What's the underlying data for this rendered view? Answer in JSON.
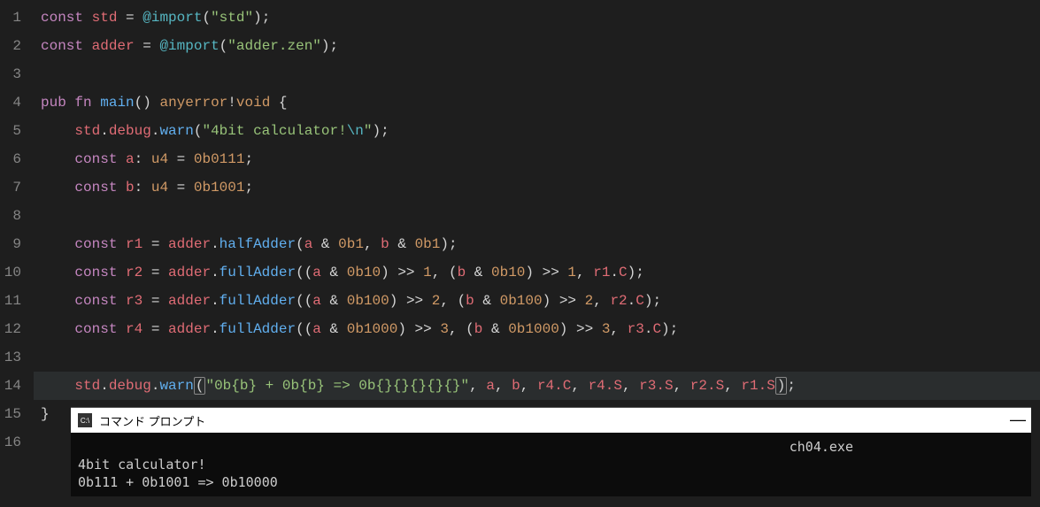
{
  "editor": {
    "lines": [
      1,
      2,
      3,
      4,
      5,
      6,
      7,
      8,
      9,
      10,
      11,
      12,
      13,
      14,
      15,
      16
    ],
    "highlighted_line": 14,
    "tokens": {
      "l1": {
        "const": "const",
        "std": "std",
        "eq": "= ",
        "import": "@import",
        "lp": "(",
        "str": "\"std\"",
        "rp": ")",
        "sc": ";"
      },
      "l2": {
        "const": "const",
        "adder": "adder",
        "eq": "= ",
        "import": "@import",
        "lp": "(",
        "str": "\"adder.zen\"",
        "rp": ")",
        "sc": ";"
      },
      "l4": {
        "pub": "pub",
        "fn": "fn",
        "main": "main",
        "lp": "(",
        "rp": ")",
        "any": "anyerror",
        "bang": "!",
        "void": "void",
        "lb": "{"
      },
      "l5": {
        "std": "std",
        "dot1": ".",
        "debug": "debug",
        "dot2": ".",
        "warn": "warn",
        "lp": "(",
        "s1": "\"4bit calculator!",
        "esc": "\\n",
        "s2": "\"",
        "rp": ")",
        "sc": ";"
      },
      "l6": {
        "const": "const",
        "name": "a",
        "colon": ": ",
        "type": "u4",
        "eq": " = ",
        "val": "0b0111",
        "sc": ";"
      },
      "l7": {
        "const": "const",
        "name": "b",
        "colon": ": ",
        "type": "u4",
        "eq": " = ",
        "val": "0b1001",
        "sc": ";"
      },
      "l9": {
        "const": "const",
        "name": "r1",
        "eq": " = ",
        "obj": "adder",
        "dot": ".",
        "fn": "halfAdder",
        "lp": "(",
        "a": "a",
        "amp1": " & ",
        "m1": "0b1",
        "c": ", ",
        "b": "b",
        "amp2": " & ",
        "m2": "0b1",
        "rp": ")",
        "sc": ";"
      },
      "l10": {
        "const": "const",
        "name": "r2",
        "eq": " = ",
        "obj": "adder",
        "dot": ".",
        "fn": "fullAdder",
        "t": "((a & 0b10) >> 1, (b & 0b10) >> 1, r1.C)",
        "sc": ";",
        "a": "a",
        "m": "0b10",
        "sh": "1",
        "b": "b",
        "r": "r1",
        "C": "C"
      },
      "l11": {
        "const": "const",
        "name": "r3",
        "eq": " = ",
        "obj": "adder",
        "dot": ".",
        "fn": "fullAdder",
        "a": "a",
        "m": "0b100",
        "sh": "2",
        "b": "b",
        "r": "r2",
        "C": "C",
        "sc": ";"
      },
      "l12": {
        "const": "const",
        "name": "r4",
        "eq": " = ",
        "obj": "adder",
        "dot": ".",
        "fn": "fullAdder",
        "a": "a",
        "m": "0b1000",
        "sh": "3",
        "b": "b",
        "r": "r3",
        "C": "C",
        "sc": ";"
      },
      "l14": {
        "std": "std",
        "debug": "debug",
        "warn": "warn",
        "str": "\"0b{b} + 0b{b} => 0b{}{}{}{}{}\"",
        "a": "a",
        "b": "b",
        "r4c": "r4.C",
        "r4s": "r4.S",
        "r3s": "r3.S",
        "r2s": "r2.S",
        "r1s": "r1.S",
        "sc": ";"
      },
      "l15": {
        "rb": "}"
      }
    }
  },
  "terminal": {
    "title": "コマンド プロンプト",
    "icon_text": "C:\\",
    "exe": "ch04.exe",
    "out1": "4bit calculator!",
    "out2": "0b111 + 0b1001 => 0b10000"
  }
}
